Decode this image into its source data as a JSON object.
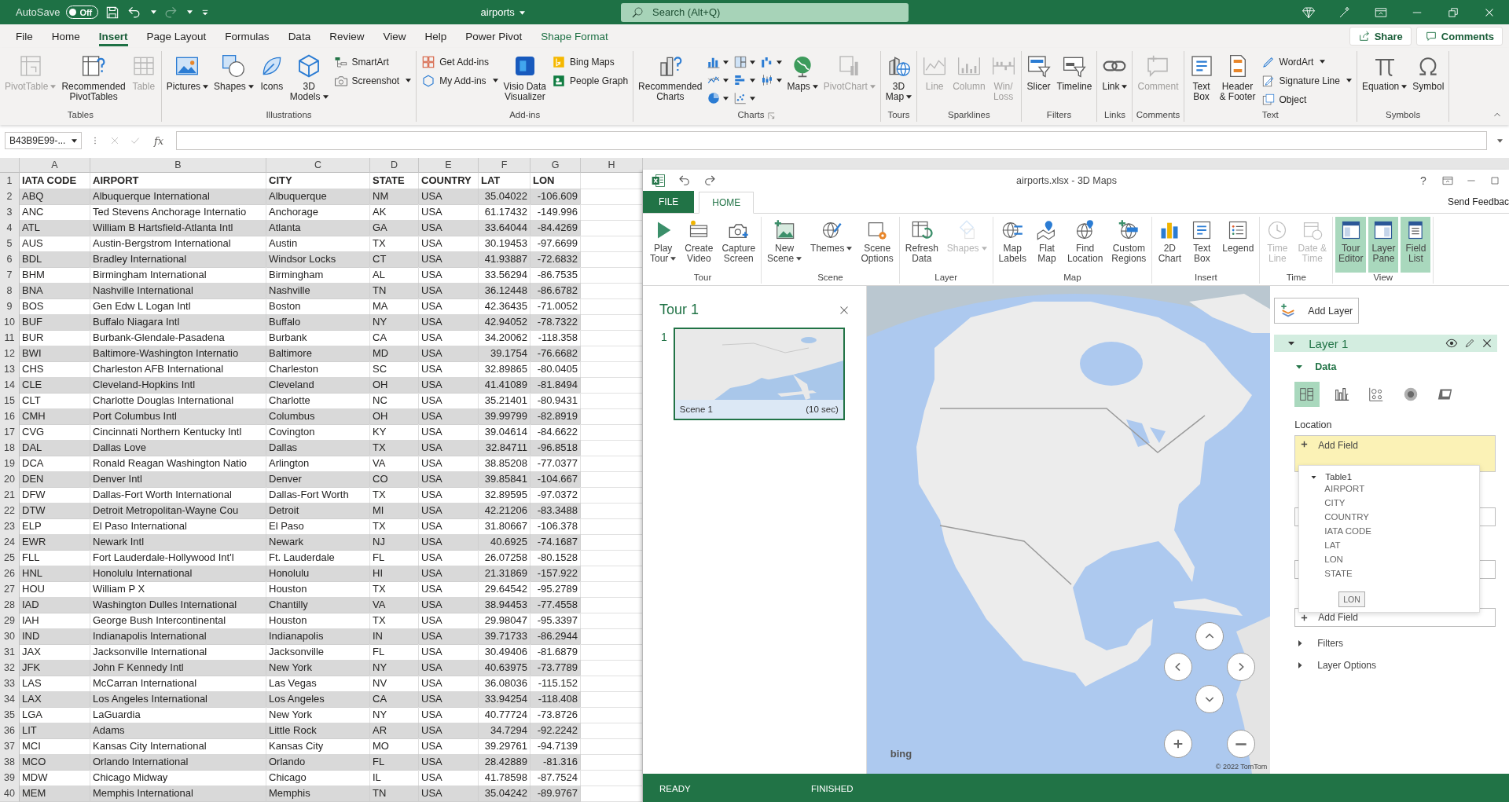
{
  "excel": {
    "title_bar": {
      "autosave_label": "AutoSave",
      "autosave": {
        "on": false,
        "label": "Off"
      },
      "document": "airports",
      "search": {
        "placeholder": "Search (Alt+Q)"
      }
    },
    "menu_tabs": [
      {
        "label": "File",
        "selected": false,
        "kind": "standard"
      },
      {
        "label": "Home",
        "selected": false,
        "kind": "standard"
      },
      {
        "label": "Insert",
        "selected": true,
        "kind": "standard"
      },
      {
        "label": "Page Layout",
        "selected": false,
        "kind": "standard"
      },
      {
        "label": "Formulas",
        "selected": false,
        "kind": "standard"
      },
      {
        "label": "Data",
        "selected": false,
        "kind": "standard"
      },
      {
        "label": "Review",
        "selected": false,
        "kind": "standard"
      },
      {
        "label": "View",
        "selected": false,
        "kind": "standard"
      },
      {
        "label": "Help",
        "selected": false,
        "kind": "standard"
      },
      {
        "label": "Power Pivot",
        "selected": false,
        "kind": "standard"
      },
      {
        "label": "Shape Format",
        "selected": false,
        "kind": "contextual"
      }
    ],
    "share": "Share",
    "comments": "Comments",
    "ribbon": [
      {
        "name": "Tables",
        "launcher": false,
        "items": [
          {
            "kind": "large",
            "label": "PivotTable",
            "disabled": true,
            "dropdown": true
          },
          {
            "kind": "large",
            "label": "Recommended\nPivotTables",
            "disabled": false,
            "dropdown": false
          },
          {
            "kind": "large",
            "label": "Table",
            "disabled": true,
            "dropdown": false
          }
        ]
      },
      {
        "name": "Illustrations",
        "launcher": false,
        "items": [
          {
            "kind": "large",
            "label": "Pictures",
            "disabled": false,
            "dropdown": true
          },
          {
            "kind": "large",
            "label": "Shapes",
            "disabled": false,
            "dropdown": true
          },
          {
            "kind": "large",
            "label": "Icons",
            "disabled": false,
            "dropdown": false
          },
          {
            "kind": "large",
            "label": "3D\nModels",
            "disabled": false,
            "dropdown": true
          },
          {
            "kind": "stack",
            "items": [
              {
                "label": "SmartArt",
                "disabled": false,
                "dropdown": false
              },
              {
                "label": "Screenshot",
                "disabled": false,
                "dropdown": true
              }
            ]
          }
        ]
      },
      {
        "name": "Add-ins",
        "launcher": false,
        "items": [
          {
            "kind": "stack",
            "items": [
              {
                "label": "Get Add-ins",
                "disabled": false,
                "dropdown": false
              },
              {
                "label": "My Add-ins",
                "disabled": false,
                "dropdown": true
              }
            ]
          },
          {
            "kind": "large",
            "label": "Visio Data\nVisualizer",
            "disabled": false,
            "dropdown": false
          },
          {
            "kind": "stack",
            "items": [
              {
                "label": "Bing Maps",
                "disabled": false,
                "dropdown": false
              },
              {
                "label": "People Graph",
                "disabled": false,
                "dropdown": false
              }
            ]
          }
        ]
      },
      {
        "name": "Charts",
        "launcher": true,
        "items": [
          {
            "kind": "large",
            "label": "Recommended\nCharts",
            "disabled": false,
            "dropdown": false
          },
          {
            "kind": "icons",
            "items": [
              {
                "disabled": false,
                "dropdown": true
              },
              {
                "disabled": false,
                "dropdown": true
              },
              {
                "disabled": false,
                "dropdown": true
              },
              {
                "disabled": false,
                "dropdown": true
              },
              {
                "disabled": false,
                "dropdown": true
              },
              {
                "disabled": false,
                "dropdown": true
              },
              {
                "disabled": false,
                "dropdown": true
              },
              {
                "disabled": false,
                "dropdown": true
              }
            ]
          },
          {
            "kind": "large",
            "label": "Maps",
            "disabled": false,
            "dropdown": true
          },
          {
            "kind": "large",
            "label": "PivotChart",
            "disabled": true,
            "dropdown": true
          }
        ]
      },
      {
        "name": "Tours",
        "launcher": false,
        "items": [
          {
            "kind": "large",
            "label": "3D\nMap",
            "disabled": false,
            "dropdown": true
          }
        ]
      },
      {
        "name": "Sparklines",
        "launcher": false,
        "items": [
          {
            "kind": "large",
            "label": "Line",
            "disabled": true,
            "dropdown": false
          },
          {
            "kind": "large",
            "label": "Column",
            "disabled": true,
            "dropdown": false
          },
          {
            "kind": "large",
            "label": "Win/\nLoss",
            "disabled": true,
            "dropdown": false
          }
        ]
      },
      {
        "name": "Filters",
        "launcher": false,
        "items": [
          {
            "kind": "large",
            "label": "Slicer",
            "disabled": false,
            "dropdown": false
          },
          {
            "kind": "large",
            "label": "Timeline",
            "disabled": false,
            "dropdown": false
          }
        ]
      },
      {
        "name": "Links",
        "launcher": false,
        "items": [
          {
            "kind": "large",
            "label": "Link",
            "disabled": false,
            "dropdown": true
          }
        ]
      },
      {
        "name": "Comments",
        "launcher": false,
        "items": [
          {
            "kind": "large",
            "label": "Comment",
            "disabled": true,
            "dropdown": false
          }
        ]
      },
      {
        "name": "Text",
        "launcher": false,
        "items": [
          {
            "kind": "large",
            "label": "Text\nBox",
            "disabled": false,
            "dropdown": false
          },
          {
            "kind": "large",
            "label": "Header\n& Footer",
            "disabled": false,
            "dropdown": false
          },
          {
            "kind": "stack",
            "items": [
              {
                "label": "WordArt",
                "disabled": false,
                "dropdown": true
              },
              {
                "label": "Signature Line",
                "disabled": false,
                "dropdown": true
              },
              {
                "label": "Object",
                "disabled": false,
                "dropdown": false
              }
            ]
          }
        ]
      },
      {
        "name": "Symbols",
        "launcher": false,
        "items": [
          {
            "kind": "large",
            "label": "Equation",
            "disabled": false,
            "dropdown": true
          },
          {
            "kind": "large",
            "label": "Symbol",
            "disabled": false,
            "dropdown": false
          }
        ]
      }
    ],
    "formula_bar": {
      "name_box": "B43B9E99-...",
      "insert_function": "fx"
    },
    "sheet": {
      "column_letters": [
        "A",
        "B",
        "C",
        "D",
        "E",
        "F",
        "G",
        "H"
      ],
      "header": {
        "n": "1",
        "cells": [
          "IATA CODE",
          "AIRPORT",
          "CITY",
          "STATE",
          "COUNTRY",
          "LAT",
          "LON"
        ]
      },
      "rows": [
        {
          "n": "2",
          "cells": [
            "ABQ",
            "Albuquerque International",
            "Albuquerque",
            "NM",
            "USA",
            "35.04022",
            "-106.609"
          ]
        },
        {
          "n": "3",
          "cells": [
            "ANC",
            "Ted Stevens Anchorage Internatio",
            "Anchorage",
            "AK",
            "USA",
            "61.17432",
            "-149.996"
          ]
        },
        {
          "n": "4",
          "cells": [
            "ATL",
            "William B Hartsfield-Atlanta Intl",
            "Atlanta",
            "GA",
            "USA",
            "33.64044",
            "-84.4269"
          ]
        },
        {
          "n": "5",
          "cells": [
            "AUS",
            "Austin-Bergstrom International",
            "Austin",
            "TX",
            "USA",
            "30.19453",
            "-97.6699"
          ]
        },
        {
          "n": "6",
          "cells": [
            "BDL",
            "Bradley International",
            "Windsor Locks",
            "CT",
            "USA",
            "41.93887",
            "-72.6832"
          ]
        },
        {
          "n": "7",
          "cells": [
            "BHM",
            "Birmingham International",
            "Birmingham",
            "AL",
            "USA",
            "33.56294",
            "-86.7535"
          ]
        },
        {
          "n": "8",
          "cells": [
            "BNA",
            "Nashville International",
            "Nashville",
            "TN",
            "USA",
            "36.12448",
            "-86.6782"
          ]
        },
        {
          "n": "9",
          "cells": [
            "BOS",
            "Gen Edw L Logan Intl",
            "Boston",
            "MA",
            "USA",
            "42.36435",
            "-71.0052"
          ]
        },
        {
          "n": "10",
          "cells": [
            "BUF",
            "Buffalo Niagara Intl",
            "Buffalo",
            "NY",
            "USA",
            "42.94052",
            "-78.7322"
          ]
        },
        {
          "n": "11",
          "cells": [
            "BUR",
            "Burbank-Glendale-Pasadena",
            "Burbank",
            "CA",
            "USA",
            "34.20062",
            "-118.358"
          ]
        },
        {
          "n": "12",
          "cells": [
            "BWI",
            "Baltimore-Washington Internatio",
            "Baltimore",
            "MD",
            "USA",
            "39.1754",
            "-76.6682"
          ]
        },
        {
          "n": "13",
          "cells": [
            "CHS",
            "Charleston AFB International",
            "Charleston",
            "SC",
            "USA",
            "32.89865",
            "-80.0405"
          ]
        },
        {
          "n": "14",
          "cells": [
            "CLE",
            "Cleveland-Hopkins Intl",
            "Cleveland",
            "OH",
            "USA",
            "41.41089",
            "-81.8494"
          ]
        },
        {
          "n": "15",
          "cells": [
            "CLT",
            "Charlotte Douglas International",
            "Charlotte",
            "NC",
            "USA",
            "35.21401",
            "-80.9431"
          ]
        },
        {
          "n": "16",
          "cells": [
            "CMH",
            "Port Columbus Intl",
            "Columbus",
            "OH",
            "USA",
            "39.99799",
            "-82.8919"
          ]
        },
        {
          "n": "17",
          "cells": [
            "CVG",
            "Cincinnati Northern Kentucky Intl",
            "Covington",
            "KY",
            "USA",
            "39.04614",
            "-84.6622"
          ]
        },
        {
          "n": "18",
          "cells": [
            "DAL",
            "Dallas Love",
            "Dallas",
            "TX",
            "USA",
            "32.84711",
            "-96.8518"
          ]
        },
        {
          "n": "19",
          "cells": [
            "DCA",
            "Ronald Reagan Washington Natio",
            "Arlington",
            "VA",
            "USA",
            "38.85208",
            "-77.0377"
          ]
        },
        {
          "n": "20",
          "cells": [
            "DEN",
            "Denver Intl",
            "Denver",
            "CO",
            "USA",
            "39.85841",
            "-104.667"
          ]
        },
        {
          "n": "21",
          "cells": [
            "DFW",
            "Dallas-Fort Worth International",
            "Dallas-Fort Worth",
            "TX",
            "USA",
            "32.89595",
            "-97.0372"
          ]
        },
        {
          "n": "22",
          "cells": [
            "DTW",
            "Detroit Metropolitan-Wayne Cou",
            "Detroit",
            "MI",
            "USA",
            "42.21206",
            "-83.3488"
          ]
        },
        {
          "n": "23",
          "cells": [
            "ELP",
            "El Paso International",
            "El Paso",
            "TX",
            "USA",
            "31.80667",
            "-106.378"
          ]
        },
        {
          "n": "24",
          "cells": [
            "EWR",
            "Newark Intl",
            "Newark",
            "NJ",
            "USA",
            "40.6925",
            "-74.1687"
          ]
        },
        {
          "n": "25",
          "cells": [
            "FLL",
            "Fort Lauderdale-Hollywood Int'l",
            "Ft. Lauderdale",
            "FL",
            "USA",
            "26.07258",
            "-80.1528"
          ]
        },
        {
          "n": "26",
          "cells": [
            "HNL",
            "Honolulu International",
            "Honolulu",
            "HI",
            "USA",
            "21.31869",
            "-157.922"
          ]
        },
        {
          "n": "27",
          "cells": [
            "HOU",
            "William P X",
            "Houston",
            "TX",
            "USA",
            "29.64542",
            "-95.2789"
          ]
        },
        {
          "n": "28",
          "cells": [
            "IAD",
            "Washington Dulles International",
            "Chantilly",
            "VA",
            "USA",
            "38.94453",
            "-77.4558"
          ]
        },
        {
          "n": "29",
          "cells": [
            "IAH",
            "George Bush Intercontinental",
            "Houston",
            "TX",
            "USA",
            "29.98047",
            "-95.3397"
          ]
        },
        {
          "n": "30",
          "cells": [
            "IND",
            "Indianapolis International",
            "Indianapolis",
            "IN",
            "USA",
            "39.71733",
            "-86.2944"
          ]
        },
        {
          "n": "31",
          "cells": [
            "JAX",
            "Jacksonville International",
            "Jacksonville",
            "FL",
            "USA",
            "30.49406",
            "-81.6879"
          ]
        },
        {
          "n": "32",
          "cells": [
            "JFK",
            "John F Kennedy Intl",
            "New York",
            "NY",
            "USA",
            "40.63975",
            "-73.7789"
          ]
        },
        {
          "n": "33",
          "cells": [
            "LAS",
            "McCarran International",
            "Las Vegas",
            "NV",
            "USA",
            "36.08036",
            "-115.152"
          ]
        },
        {
          "n": "34",
          "cells": [
            "LAX",
            "Los Angeles International",
            "Los Angeles",
            "CA",
            "USA",
            "33.94254",
            "-118.408"
          ]
        },
        {
          "n": "35",
          "cells": [
            "LGA",
            "LaGuardia",
            "New York",
            "NY",
            "USA",
            "40.77724",
            "-73.8726"
          ]
        },
        {
          "n": "36",
          "cells": [
            "LIT",
            "Adams",
            "Little Rock",
            "AR",
            "USA",
            "34.7294",
            "-92.2242"
          ]
        },
        {
          "n": "37",
          "cells": [
            "MCI",
            "Kansas City International",
            "Kansas City",
            "MO",
            "USA",
            "39.29761",
            "-94.7139"
          ]
        },
        {
          "n": "38",
          "cells": [
            "MCO",
            "Orlando International",
            "Orlando",
            "FL",
            "USA",
            "28.42889",
            "-81.316"
          ]
        },
        {
          "n": "39",
          "cells": [
            "MDW",
            "Chicago Midway",
            "Chicago",
            "IL",
            "USA",
            "41.78598",
            "-87.7524"
          ]
        },
        {
          "n": "40",
          "cells": [
            "MEM",
            "Memphis International",
            "Memphis",
            "TN",
            "USA",
            "35.04242",
            "-89.9767"
          ]
        }
      ]
    }
  },
  "maps_window": {
    "title": "airports.xlsx - 3D Maps",
    "help": "?",
    "tabs": [
      {
        "label": "FILE",
        "kind": "file",
        "selected": false
      },
      {
        "label": "HOME",
        "kind": "tab",
        "selected": true
      }
    ],
    "send_feedback": "Send Feedbac",
    "ribbon": [
      {
        "name": "Tour",
        "items": [
          {
            "label": "Play\nTour",
            "dropdown": true,
            "disabled": false,
            "on": false
          },
          {
            "label": "Create\nVideo",
            "dropdown": false,
            "disabled": false,
            "on": false
          },
          {
            "label": "Capture\nScreen",
            "dropdown": false,
            "disabled": false,
            "on": false
          }
        ]
      },
      {
        "name": "Scene",
        "items": [
          {
            "label": "New\nScene",
            "dropdown": true,
            "disabled": false,
            "on": false
          },
          {
            "label": "Themes",
            "dropdown": true,
            "disabled": false,
            "on": false
          },
          {
            "label": "Scene\nOptions",
            "dropdown": false,
            "disabled": false,
            "on": false
          }
        ]
      },
      {
        "name": "Layer",
        "items": [
          {
            "label": "Refresh\nData",
            "dropdown": false,
            "disabled": false,
            "on": false
          },
          {
            "label": "Shapes",
            "dropdown": true,
            "disabled": true,
            "on": false
          }
        ]
      },
      {
        "name": "Map",
        "items": [
          {
            "label": "Map\nLabels",
            "dropdown": false,
            "disabled": false,
            "on": false
          },
          {
            "label": "Flat\nMap",
            "dropdown": false,
            "disabled": false,
            "on": false
          },
          {
            "label": "Find\nLocation",
            "dropdown": false,
            "disabled": false,
            "on": false
          },
          {
            "label": "Custom\nRegions",
            "dropdown": false,
            "disabled": false,
            "on": false
          }
        ]
      },
      {
        "name": "Insert",
        "items": [
          {
            "label": "2D\nChart",
            "dropdown": false,
            "disabled": false,
            "on": false
          },
          {
            "label": "Text\nBox",
            "dropdown": false,
            "disabled": false,
            "on": false
          },
          {
            "label": "Legend",
            "dropdown": false,
            "disabled": false,
            "on": false
          }
        ]
      },
      {
        "name": "Time",
        "items": [
          {
            "label": "Time\nLine",
            "dropdown": false,
            "disabled": true,
            "on": false
          },
          {
            "label": "Date &\nTime",
            "dropdown": false,
            "disabled": true,
            "on": false
          }
        ]
      },
      {
        "name": "View",
        "items": [
          {
            "label": "Tour\nEditor",
            "dropdown": false,
            "disabled": false,
            "on": true
          },
          {
            "label": "Layer\nPane",
            "dropdown": false,
            "disabled": false,
            "on": true
          },
          {
            "label": "Field\nList",
            "dropdown": false,
            "disabled": false,
            "on": true
          }
        ]
      }
    ],
    "tour_pane": {
      "title": "Tour 1",
      "scenes": [
        {
          "number": "1",
          "name": "Scene 1",
          "duration": "(10 sec)",
          "selected": true
        }
      ]
    },
    "map": {
      "logo": "bing",
      "attribution": "© 2022 TomTom"
    },
    "layer_pane": {
      "add_layer": "Add Layer",
      "layer": {
        "name": "Layer 1",
        "expanded": true,
        "data": {
          "title": "Data",
          "expanded": true,
          "viz_types": [
            {
              "selected": true
            },
            {
              "selected": false
            },
            {
              "selected": false
            },
            {
              "selected": false
            },
            {
              "selected": false
            }
          ],
          "location_label": "Location",
          "add_field": "Add Field",
          "field_list": {
            "table": "Table1",
            "expanded": true,
            "fields": [
              "AIRPORT",
              "CITY",
              "COUNTRY",
              "IATA CODE",
              "LAT",
              "LON",
              "STATE"
            ]
          },
          "tooltip": "LON",
          "second_add_field": "Add Field"
        },
        "sections": [
          {
            "title": "Filters",
            "expanded": false
          },
          {
            "title": "Layer Options",
            "expanded": false
          }
        ]
      }
    },
    "status_bar": [
      "READY",
      "FINISHED"
    ]
  }
}
